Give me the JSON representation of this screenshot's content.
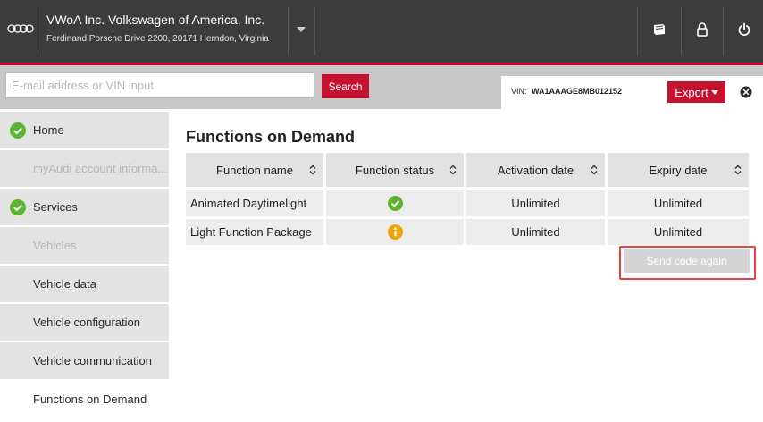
{
  "header": {
    "company_name": "VWoA Inc. Volkswagen of America, Inc.",
    "company_address": "Ferdinand Porsche Drive 2200, 20171 Herndon, Virginia",
    "icons": [
      "book-icon",
      "lock-icon",
      "power-icon"
    ]
  },
  "search": {
    "placeholder": "E-mail address or VIN input",
    "value": "",
    "button_label": "Search"
  },
  "vin": {
    "label": "VIN:",
    "value": "WA1AAAGE8MB012152",
    "export_label": "Export"
  },
  "sidebar": {
    "items": [
      {
        "label": "Home",
        "checked": true,
        "state": "normal"
      },
      {
        "label": "myAudi account informa...",
        "checked": false,
        "state": "disabled"
      },
      {
        "label": "Services",
        "checked": true,
        "state": "normal"
      },
      {
        "label": "Vehicles",
        "checked": false,
        "state": "disabled"
      },
      {
        "label": "Vehicle data",
        "checked": false,
        "state": "normal"
      },
      {
        "label": "Vehicle configuration",
        "checked": false,
        "state": "normal"
      },
      {
        "label": "Vehicle communication",
        "checked": false,
        "state": "normal"
      },
      {
        "label": "Functions on Demand",
        "checked": false,
        "state": "active"
      }
    ]
  },
  "main": {
    "title": "Functions on Demand",
    "table": {
      "columns": [
        "Function name",
        "Function status",
        "Activation date",
        "Expiry date"
      ],
      "rows": [
        {
          "function_name": "Animated Daytimelight",
          "status": "active",
          "status_icon": "check-circle-icon",
          "activation_date": "Unlimited",
          "expiry_date": "Unlimited"
        },
        {
          "function_name": "Light Function Package",
          "status": "info",
          "status_icon": "info-circle-icon",
          "activation_date": "Unlimited",
          "expiry_date": "Unlimited"
        }
      ]
    },
    "send_code_label": "Send code again"
  },
  "colors": {
    "header_bg": "#3c3c3c",
    "accent_red": "#c4122f",
    "check_green": "#5cb531",
    "info_orange": "#f0a30a",
    "highlight_red": "#e0453f"
  }
}
